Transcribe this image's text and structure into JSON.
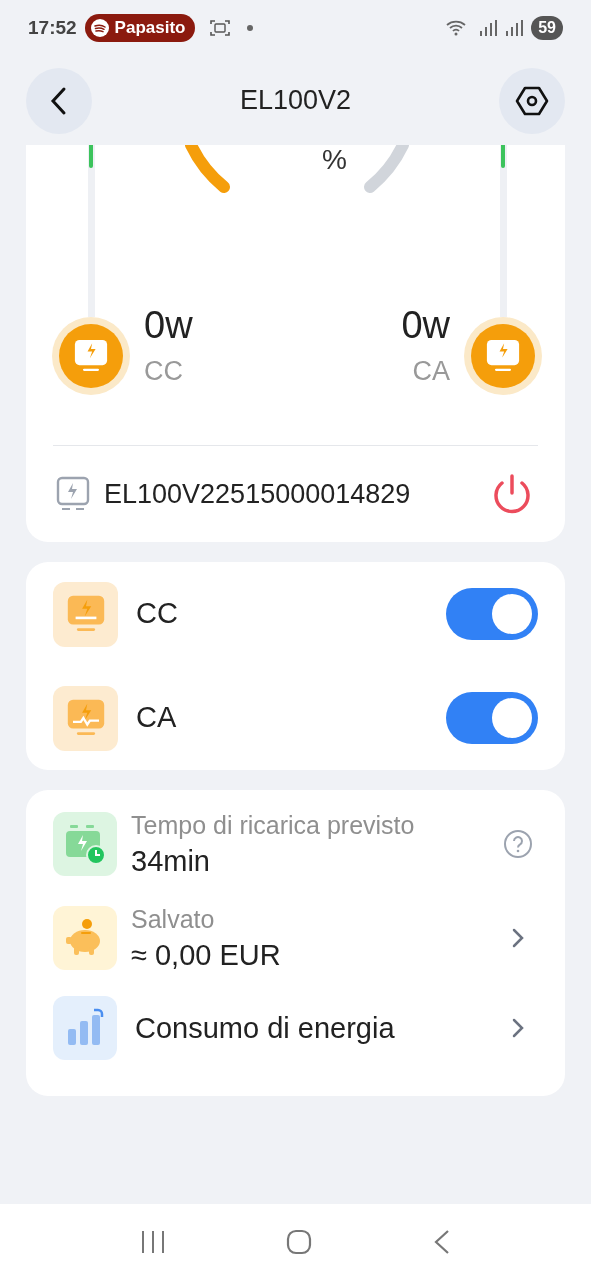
{
  "status_bar": {
    "time": "17:52",
    "media_chip": "Papasito",
    "battery": "59"
  },
  "header": {
    "title": "EL100V2"
  },
  "gauge": {
    "unit": "%"
  },
  "ports": [
    {
      "value": "0w",
      "label": "CC",
      "kind": "dc"
    },
    {
      "value": "0w",
      "label": "CA",
      "kind": "ac"
    }
  ],
  "device": {
    "serial": "EL100V22515000014829"
  },
  "outputs": [
    {
      "label": "CC",
      "kind": "dc",
      "on": true
    },
    {
      "label": "CA",
      "kind": "ac",
      "on": true
    }
  ],
  "stats": [
    {
      "kind": "time",
      "title": "Tempo di ricarica previsto",
      "value": "34min",
      "accessory": {
        "kind": "help"
      }
    },
    {
      "kind": "savings",
      "title": "Salvato",
      "value": "≈ 0,00 EUR",
      "accessory": {
        "kind": "chevron"
      }
    },
    {
      "kind": "energy",
      "label": "Consumo di energia",
      "accessory": {
        "kind": "chevron"
      }
    }
  ]
}
